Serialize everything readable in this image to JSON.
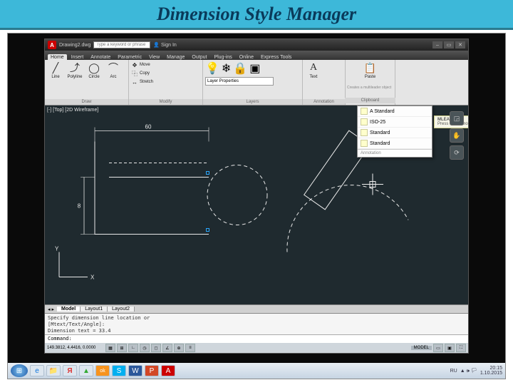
{
  "slideTitle": "Dimension Style Manager",
  "app": {
    "name": "A",
    "docTitle": "Drawing2.dwg",
    "searchPlaceholder": "Type a keyword or phrase",
    "signIn": "Sign In"
  },
  "tabs": [
    "Home",
    "Insert",
    "Annotate",
    "Parametric",
    "View",
    "Manage",
    "Output",
    "Plug-ins",
    "Online",
    "Express Tools"
  ],
  "ribbon": {
    "draw": {
      "label": "Draw",
      "items": [
        "Line",
        "Polyline",
        "Circle",
        "Arc"
      ]
    },
    "modify": {
      "label": "Modify",
      "move": "Move",
      "copy": "Copy",
      "stretch": "Stretch"
    },
    "layers": {
      "label": "Layers",
      "dropdown": "Layer Properties"
    },
    "annotation": {
      "label": "Annotation",
      "text": "Text"
    },
    "clipboard": {
      "label": "Clipboard",
      "paste": "Paste",
      "hint": "Creates a multileader object"
    }
  },
  "styleDropdown": {
    "items": [
      "A Standard",
      "ISO-25",
      "Standard",
      "Standard"
    ],
    "footer": "Annotation",
    "help": "Press F1 for more help",
    "mleader": "MLEADER"
  },
  "viewport": "[-] [Top] [2D Wireframe]",
  "ucs": {
    "x": "X",
    "y": "Y"
  },
  "dims": {
    "top": "60",
    "left": "8"
  },
  "modelTabs": [
    "Model",
    "Layout1",
    "Layout2"
  ],
  "cmd": {
    "line1": "Specify dimension line location or",
    "line2": "[Mtext/Text/Angle]:",
    "line3": "Dimension text = 33.4",
    "prompt": "Command:"
  },
  "status": {
    "coords": "149.3812, 4.4416, 0.0000",
    "model": "MODEL"
  },
  "taskIcons": [
    "⊞",
    "e",
    "📁",
    "Я",
    "📓",
    "ok",
    "S",
    "W",
    "P",
    "A"
  ],
  "tray": {
    "time": "20:15",
    "date": "1.10.2015",
    "lang": "RU"
  }
}
